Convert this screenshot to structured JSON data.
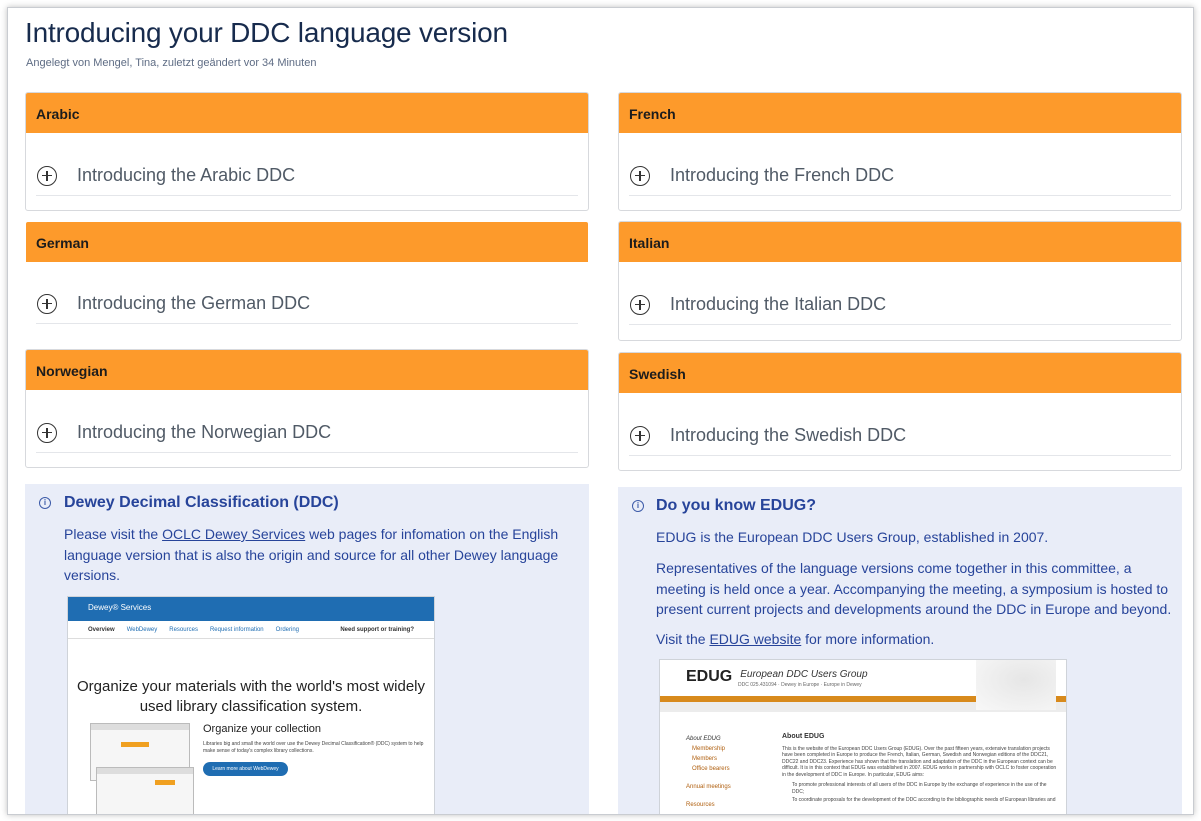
{
  "page": {
    "title": "Introducing your DDC language version",
    "byline": "Angelegt von Mengel, Tina, zuletzt geändert vor 34 Minuten"
  },
  "panels": {
    "arabic": {
      "heading": "Arabic",
      "expand": "Introducing the Arabic DDC"
    },
    "french": {
      "heading": "French",
      "expand": "Introducing the French DDC"
    },
    "german": {
      "heading": "German",
      "expand": "Introducing the German DDC"
    },
    "italian": {
      "heading": "Italian",
      "expand": "Introducing the Italian DDC"
    },
    "norwegian": {
      "heading": "Norwegian",
      "expand": "Introducing the Norwegian DDC"
    },
    "swedish": {
      "heading": "Swedish",
      "expand": "Introducing the Swedish DDC"
    }
  },
  "ddc_info": {
    "title": "Dewey Decimal Classification (DDC)",
    "text_before": "Please visit the ",
    "link": "OCLC Dewey Services",
    "text_after": " web pages for infomation on the English language version that is also the origin and source for all other Dewey language versions.",
    "screenshot": {
      "brand": "Dewey® Services",
      "nav": [
        "Overview",
        "WebDewey",
        "Resources",
        "Request information",
        "Ordering"
      ],
      "nav_right": "Need support or training?",
      "hero_line1": "Organize your materials with the world's most widely",
      "hero_line2": "used library classification system.",
      "subhead": "Organize your collection",
      "para": "Libraries big and small the world over use the Dewey Decimal Classification® (DDC) system to help make sense of today's complex library collections.",
      "button": "Learn more about WebDewey"
    }
  },
  "edug_info": {
    "title": "Do you know EDUG?",
    "p1": "EDUG is the European DDC Users Group, established in 2007.",
    "p2": "Representatives of the language versions come together in this committee, a meeting is held once a year. Accompanying the meeting, a symposium is hosted to present current projects and developments around the DDC in Europe and beyond.",
    "p3_before": "Visit the ",
    "p3_link": "EDUG website",
    "p3_after": " for more information.",
    "screenshot": {
      "logo": "EDUG",
      "name": "European DDC Users Group",
      "tag": "DDC 025.431094 · Dewey in Europe · Europe in Dewey",
      "left_heading": "About EDUG",
      "left_items": [
        "Membership",
        "Members",
        "Office bearers"
      ],
      "left_more": [
        "Annual meetings",
        "Resources"
      ],
      "main_heading": "About EDUG",
      "main_text": "This is the website of the European DDC Users Group (EDUG). Over the past fifteen years, extensive translation projects have been completed in Europe to produce the French, Italian, German, Swedish and Norwegian editions of the DDC21, DDC22 and DDC23. Experience has shown that the translation and adaptation of the DDC in the European context can be difficult. It is in this context that EDUG was established in 2007. EDUG works in partnership with OCLC to foster cooperation in the development of DDC in Europe. In particular, EDUG aims:",
      "bullet1": "To promote professional interests of all users of the DDC in Europe by the exchange of experience in the use of the DDC;",
      "bullet2": "To coordinate proposals for the development of the DDC according to the bibliographic needs of European libraries and"
    }
  }
}
